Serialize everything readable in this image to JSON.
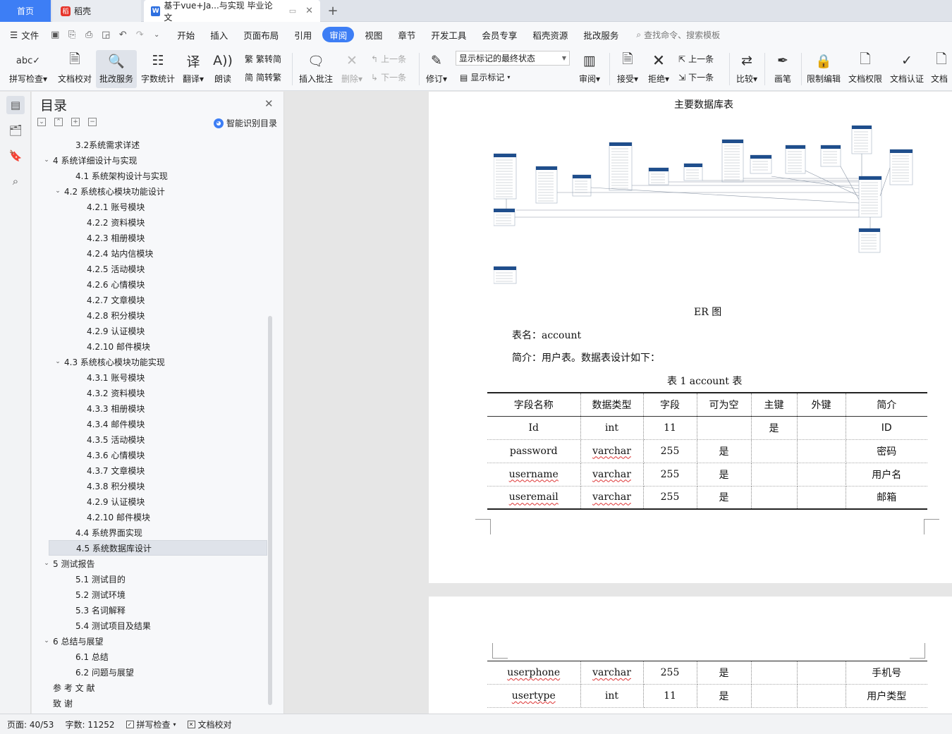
{
  "tabs": {
    "home": "首页",
    "daoke": "稻壳",
    "doc": "基于vue+Ja...与实现 毕业论文"
  },
  "menubar": {
    "file": "文件",
    "items": [
      "开始",
      "插入",
      "页面布局",
      "引用",
      "审阅",
      "视图",
      "章节",
      "开发工具",
      "会员专享",
      "稻壳资源",
      "批改服务"
    ],
    "active": "审阅",
    "search": "查找命令、搜索模板"
  },
  "ribbon": {
    "spell": "拼写检查",
    "proof": "文档校对",
    "correct": "批改服务",
    "wordcount": "字数统计",
    "translate": "翻译",
    "read": "朗读",
    "t2s": "繁转简",
    "s2t": "简转繁",
    "insert_comment": "插入批注",
    "delete": "删除",
    "prev_comment": "上一条",
    "next_comment": "下一条",
    "revise": "修订",
    "status_select": "显示标记的最终状态",
    "show_markup": "显示标记",
    "review": "审阅",
    "accept": "接受",
    "reject": "拒绝",
    "prev": "上一条",
    "next": "下一条",
    "compare": "比较",
    "pen": "画笔",
    "restrict": "限制编辑",
    "permission": "文档权限",
    "certify": "文档认证",
    "overflow": "文档"
  },
  "toc": {
    "title": "目录",
    "smart": "智能识别目录",
    "items": [
      {
        "text": "3.2系统需求详述",
        "level": 1
      },
      {
        "text": "4  系统详细设计与实现",
        "level": 0
      },
      {
        "text": "4.1  系统架构设计与实现",
        "level": 1
      },
      {
        "text": "4.2  系统核心模块功能设计",
        "level": 1
      },
      {
        "text": "4.2.1  账号模块",
        "level": 2
      },
      {
        "text": "4.2.2  资料模块",
        "level": 2
      },
      {
        "text": "4.2.3  相册模块",
        "level": 2
      },
      {
        "text": "4.2.4  站内信模块",
        "level": 2
      },
      {
        "text": "4.2.5  活动模块",
        "level": 2
      },
      {
        "text": "4.2.6  心情模块",
        "level": 2
      },
      {
        "text": "4.2.7  文章模块",
        "level": 2
      },
      {
        "text": "4.2.8  积分模块",
        "level": 2
      },
      {
        "text": "4.2.9  认证模块",
        "level": 2
      },
      {
        "text": "4.2.10  邮件模块",
        "level": 2
      },
      {
        "text": "4.3  系统核心模块功能实现",
        "level": 1
      },
      {
        "text": "4.3.1  账号模块",
        "level": 2
      },
      {
        "text": "4.3.2  资料模块",
        "level": 2
      },
      {
        "text": "4.3.3  相册模块",
        "level": 2
      },
      {
        "text": "4.3.4  邮件模块",
        "level": 2
      },
      {
        "text": "4.3.5  活动模块",
        "level": 2
      },
      {
        "text": "4.3.6  心情模块",
        "level": 2
      },
      {
        "text": "4.3.7  文章模块",
        "level": 2
      },
      {
        "text": "4.3.8  积分模块",
        "level": 2
      },
      {
        "text": "4.2.9  认证模块",
        "level": 2
      },
      {
        "text": "4.2.10  邮件模块",
        "level": 2
      },
      {
        "text": "4.4  系统界面实现",
        "level": 1
      },
      {
        "text": "4.5  系统数据库设计",
        "level": 1
      },
      {
        "text": "5  测试报告",
        "level": 0
      },
      {
        "text": "5.1  测试目的",
        "level": 1
      },
      {
        "text": "5.2  测试环境",
        "level": 1
      },
      {
        "text": "5.3  名词解释",
        "level": 1
      },
      {
        "text": "5.4  测试项目及结果",
        "level": 1
      },
      {
        "text": "6  总结与展望",
        "level": 0
      },
      {
        "text": "6.1  总结",
        "level": 1
      },
      {
        "text": "6.2  问题与展望",
        "level": 1
      },
      {
        "text": "参 考 文 献",
        "level": 0
      },
      {
        "text": "致     谢",
        "level": 0
      }
    ],
    "expanded": [
      "4  系统详细设计与实现",
      "4.2  系统核心模块功能设计",
      "4.3  系统核心模块功能实现",
      "5  测试报告",
      "6  总结与展望"
    ],
    "selected": "4.5  系统数据库设计"
  },
  "doc": {
    "heading": "主要数据库表",
    "figure_caption": "ER 图",
    "table_name": "表名：account",
    "table_intro": "简介：用户表。数据表设计如下：",
    "table_caption": "表 1    account 表",
    "columns": [
      "字段名称",
      "数据类型",
      "字段",
      "可为空",
      "主键",
      "外键",
      "简介"
    ],
    "rows": [
      [
        "Id",
        "int",
        "11",
        "",
        "是",
        "",
        "ID"
      ],
      [
        "password",
        "varchar",
        "255",
        "是",
        "",
        "",
        "密码"
      ],
      [
        "username",
        "varchar",
        "255",
        "是",
        "",
        "",
        "用户名"
      ],
      [
        "useremail",
        "varchar",
        "255",
        "是",
        "",
        "",
        "邮箱"
      ]
    ],
    "rows_page2": [
      [
        "userphone",
        "varchar",
        "255",
        "是",
        "",
        "",
        "手机号"
      ],
      [
        "usertype",
        "int",
        "11",
        "是",
        "",
        "",
        "用户类型"
      ]
    ]
  },
  "status": {
    "page": "页面: 40/53",
    "words": "字数: 11252",
    "spell": "拼写检查",
    "proof": "文档校对"
  },
  "colors": {
    "accent": "#3d7ef5",
    "er_header": "#1f4e8c"
  }
}
